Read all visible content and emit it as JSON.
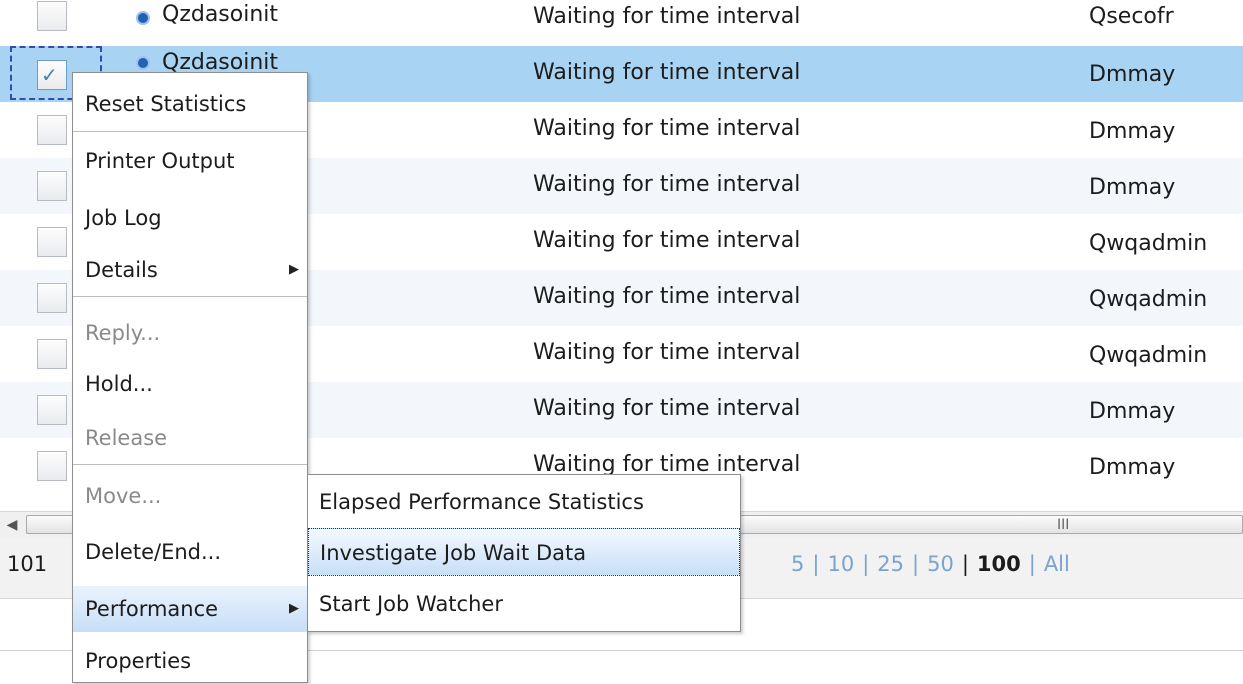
{
  "rows": [
    {
      "name": "Qzdasoinit",
      "status": "Waiting for time interval",
      "user": "Qsecofr",
      "checked": false
    },
    {
      "name": "Qzdasoinit",
      "status": "Waiting for time interval",
      "user": "Dmmay",
      "checked": true
    },
    {
      "name": "",
      "status": "Waiting for time interval",
      "user": "Dmmay",
      "checked": false
    },
    {
      "name": "",
      "status": "Waiting for time interval",
      "user": "Dmmay",
      "checked": false
    },
    {
      "name": "",
      "status": "Waiting for time interval",
      "user": "Qwqadmin",
      "checked": false
    },
    {
      "name": "",
      "status": "Waiting for time interval",
      "user": "Qwqadmin",
      "checked": false
    },
    {
      "name": "",
      "status": "Waiting for time interval",
      "user": "Qwqadmin",
      "checked": false
    },
    {
      "name": "",
      "status": "Waiting for time interval",
      "user": "Dmmay",
      "checked": false
    },
    {
      "name": "",
      "status": "Waiting for time interval",
      "user": "Dmmay",
      "checked": false
    }
  ],
  "footer": {
    "count": "101",
    "page_sizes": [
      "5",
      "10",
      "25",
      "50",
      "100",
      "All"
    ],
    "current_page_size": "100"
  },
  "context_menu": {
    "items": [
      {
        "label": "Reset Statistics",
        "enabled": true
      },
      {
        "label": "Printer Output",
        "enabled": true
      },
      {
        "label": "Job Log",
        "enabled": true
      },
      {
        "label": "Details",
        "enabled": true,
        "submenu": true
      },
      {
        "label": "Reply...",
        "enabled": false
      },
      {
        "label": "Hold...",
        "enabled": true
      },
      {
        "label": "Release",
        "enabled": false
      },
      {
        "label": "Move...",
        "enabled": false
      },
      {
        "label": "Delete/End...",
        "enabled": true
      },
      {
        "label": "Performance",
        "enabled": true,
        "submenu": true,
        "highlighted": true
      },
      {
        "label": "Properties",
        "enabled": true
      }
    ]
  },
  "performance_submenu": {
    "items": [
      {
        "label": "Elapsed Performance Statistics"
      },
      {
        "label": "Investigate Job Wait Data",
        "highlighted": true
      },
      {
        "label": "Start Job Watcher"
      }
    ]
  },
  "icons": {
    "checkbox_check": "✓",
    "submenu_arrow": "▶",
    "scroll_left": "◀",
    "scroll_grip": "III",
    "job_icon": "job-status-icon"
  },
  "colors": {
    "selected_row": "#a8d3f3",
    "alt_row": "#f3f7fc",
    "link": "#7aa3cf",
    "disabled_text": "#8a8a8a"
  }
}
